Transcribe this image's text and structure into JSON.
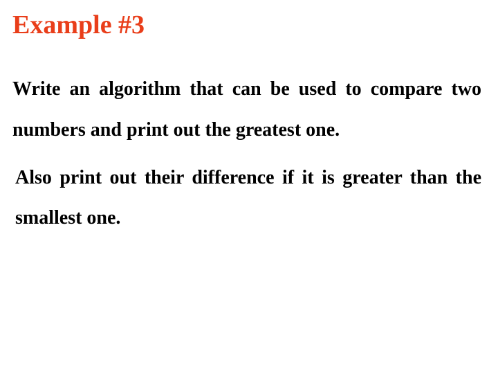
{
  "heading": "Example #3",
  "paragraph1": "Write an algorithm that can be used to compare two numbers and print out the greatest one.",
  "paragraph2": "Also print out their difference if it is greater than the smallest one."
}
